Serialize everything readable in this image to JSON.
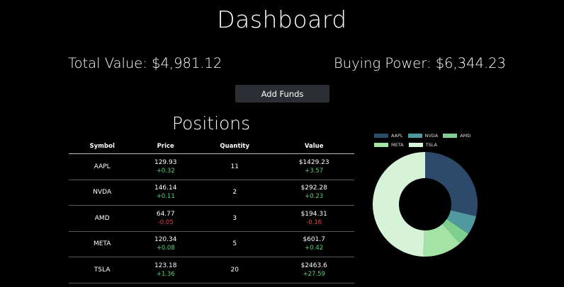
{
  "header": {
    "title": "Dashboard"
  },
  "summary": {
    "total_value": "Total Value: $4,981.12",
    "buying_power": "Buying Power: $6,344.23"
  },
  "actions": {
    "add_funds_label": "Add Funds"
  },
  "positions": {
    "title": "Positions",
    "columns": [
      "Symbol",
      "Price",
      "Quantity",
      "Value"
    ],
    "rows": [
      {
        "symbol": "AAPL",
        "price": "129.93",
        "price_change": "+0.32",
        "quantity": "11",
        "value": "$1429.23",
        "value_change": "+3.57"
      },
      {
        "symbol": "NVDA",
        "price": "146.14",
        "price_change": "+0.11",
        "quantity": "2",
        "value": "$292.28",
        "value_change": "+0.23"
      },
      {
        "symbol": "AMD",
        "price": "64.77",
        "price_change": "-0.05",
        "quantity": "3",
        "value": "$194.31",
        "value_change": "-0.16"
      },
      {
        "symbol": "META",
        "price": "120.34",
        "price_change": "+0.08",
        "quantity": "5",
        "value": "$601.7",
        "value_change": "+0.42"
      },
      {
        "symbol": "TSLA",
        "price": "123.18",
        "price_change": "+1.36",
        "quantity": "20",
        "value": "$2463.6",
        "value_change": "+27.59"
      }
    ]
  },
  "chart_data": {
    "type": "pie",
    "categories": [
      "AAPL",
      "NVDA",
      "AMD",
      "META",
      "TSLA"
    ],
    "values": [
      1429.23,
      292.28,
      194.31,
      601.7,
      2463.6
    ],
    "colors": [
      "#2e4a6b",
      "#4f9a9e",
      "#7fd08f",
      "#a4e2a6",
      "#d6f2d7"
    ],
    "legend_position": "top"
  },
  "colors": {
    "background": "#000000",
    "button": "#2b2e33",
    "positive": "#5fd07a",
    "negative": "#e04a4a"
  }
}
